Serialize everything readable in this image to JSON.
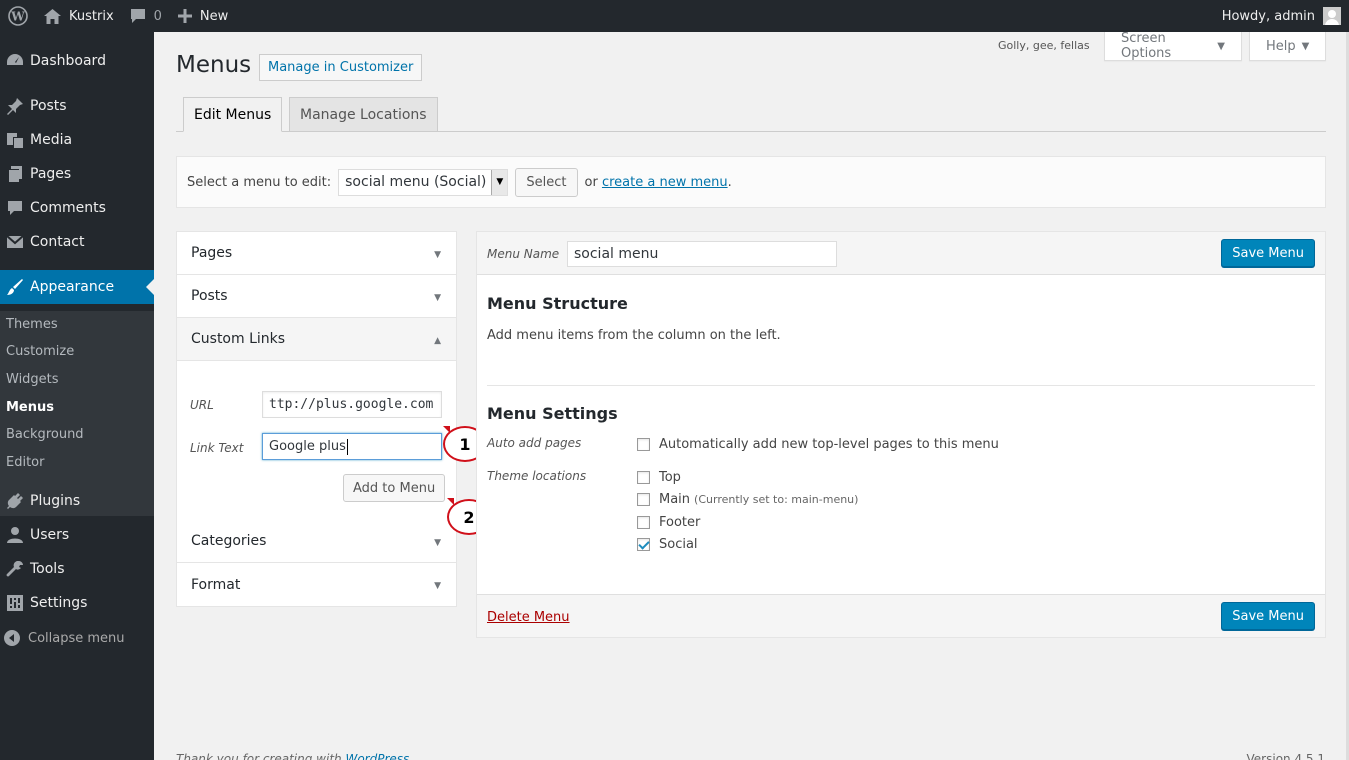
{
  "adminbar": {
    "site_name": "Kustrix",
    "comments_count": "0",
    "new_label": "New",
    "howdy": "Howdy, admin"
  },
  "sidebar": {
    "items": [
      {
        "label": "Dashboard",
        "icon": "dashboard-icon"
      },
      {
        "label": "Posts",
        "icon": "pin-icon"
      },
      {
        "label": "Media",
        "icon": "media-icon"
      },
      {
        "label": "Pages",
        "icon": "pages-icon"
      },
      {
        "label": "Comments",
        "icon": "comment-icon"
      },
      {
        "label": "Contact",
        "icon": "envelope-icon"
      },
      {
        "label": "Appearance",
        "icon": "brush-icon"
      },
      {
        "label": "Plugins",
        "icon": "plug-icon"
      },
      {
        "label": "Users",
        "icon": "user-icon"
      },
      {
        "label": "Tools",
        "icon": "wrench-icon"
      },
      {
        "label": "Settings",
        "icon": "sliders-icon"
      }
    ],
    "submenu": [
      "Themes",
      "Customize",
      "Widgets",
      "Menus",
      "Background",
      "Editor"
    ],
    "collapse_label": "Collapse menu",
    "active_color": "#0073aa"
  },
  "header": {
    "title": "Menus",
    "customizer_button": "Manage in Customizer",
    "golly": "Golly, gee, fellas",
    "screen_options": "Screen Options",
    "help": "Help"
  },
  "tabs": {
    "edit": "Edit Menus",
    "locations": "Manage Locations"
  },
  "select_bar": {
    "prompt": "Select a menu to edit:",
    "selected": "social menu (Social)",
    "select_button": "Select",
    "or_text": "or",
    "create_link": "create a new menu",
    "period": "."
  },
  "left_panels": {
    "pages": "Pages",
    "posts": "Posts",
    "custom_links": "Custom Links",
    "url_label": "URL",
    "url_value": "ttp://plus.google.com",
    "link_text_label": "Link Text",
    "link_text_value": "Google plus",
    "add_button": "Add to Menu",
    "categories": "Categories",
    "format": "Format"
  },
  "annotations": {
    "one": "1",
    "two": "2"
  },
  "menu_panel": {
    "name_label": "Menu Name",
    "name_value": "social menu",
    "save_button": "Save Menu",
    "structure_title": "Menu Structure",
    "structure_desc": "Add menu items from the column on the left.",
    "settings_title": "Menu Settings",
    "auto_add_label": "Auto add pages",
    "auto_add_text": "Automatically add new top-level pages to this menu",
    "auto_add_checked": false,
    "locations_label": "Theme locations",
    "locations": [
      {
        "label": "Top",
        "note": "",
        "checked": false
      },
      {
        "label": "Main",
        "note": "(Currently set to: main-menu)",
        "checked": false
      },
      {
        "label": "Footer",
        "note": "",
        "checked": false
      },
      {
        "label": "Social",
        "note": "",
        "checked": true
      }
    ],
    "delete_link": "Delete Menu"
  },
  "footer": {
    "thanks": "Thank you for creating with",
    "wp_link": "WordPress",
    "version": "Version 4.5.1"
  }
}
